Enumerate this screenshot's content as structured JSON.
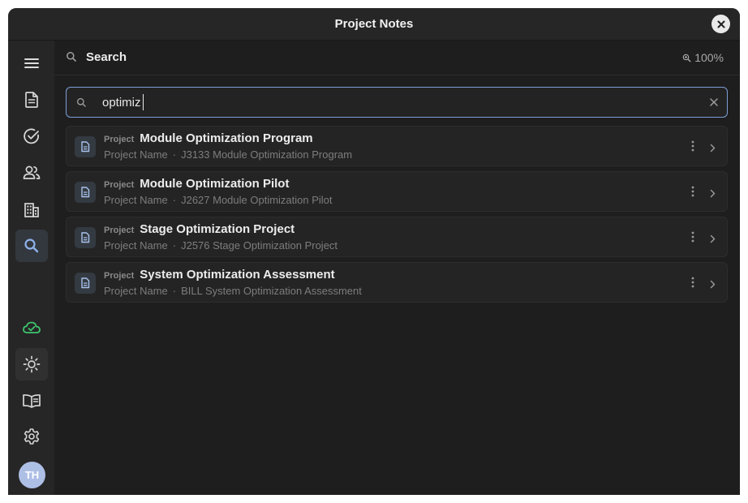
{
  "window": {
    "title": "Project Notes"
  },
  "sidebar": {
    "items": [
      {
        "name": "menu",
        "icon": "hamburger-menu-icon"
      },
      {
        "name": "documents",
        "icon": "document-icon"
      },
      {
        "name": "tasks",
        "icon": "check-circle-icon"
      },
      {
        "name": "people",
        "icon": "people-icon"
      },
      {
        "name": "buildings",
        "icon": "building-icon"
      },
      {
        "name": "search",
        "icon": "search-icon",
        "active": true
      },
      {
        "name": "sync",
        "icon": "cloud-check-icon"
      },
      {
        "name": "theme",
        "icon": "sun-icon"
      },
      {
        "name": "docs",
        "icon": "book-icon"
      },
      {
        "name": "settings",
        "icon": "gear-icon"
      }
    ],
    "avatar_initials": "TH"
  },
  "header": {
    "title": "Search",
    "zoom": "100%"
  },
  "search": {
    "value": "optimiz",
    "placeholder": ""
  },
  "results": [
    {
      "type": "Project",
      "name": "Module Optimization Program",
      "field": "Project Name",
      "match": "J3133 Module Optimization Program"
    },
    {
      "type": "Project",
      "name": "Module Optimization Pilot",
      "field": "Project Name",
      "match": "J2627 Module Optimization Pilot"
    },
    {
      "type": "Project",
      "name": "Stage Optimization Project",
      "field": "Project Name",
      "match": "J2576 Stage Optimization Project"
    },
    {
      "type": "Project",
      "name": "System Optimization Assessment",
      "field": "Project Name",
      "match": "BILL System Optimization Assessment"
    }
  ],
  "separator": "·",
  "colors": {
    "accent": "#7c9ed8",
    "sync_green": "#3ec46d",
    "background": "#1e1e1e",
    "sidebar": "#262626"
  }
}
